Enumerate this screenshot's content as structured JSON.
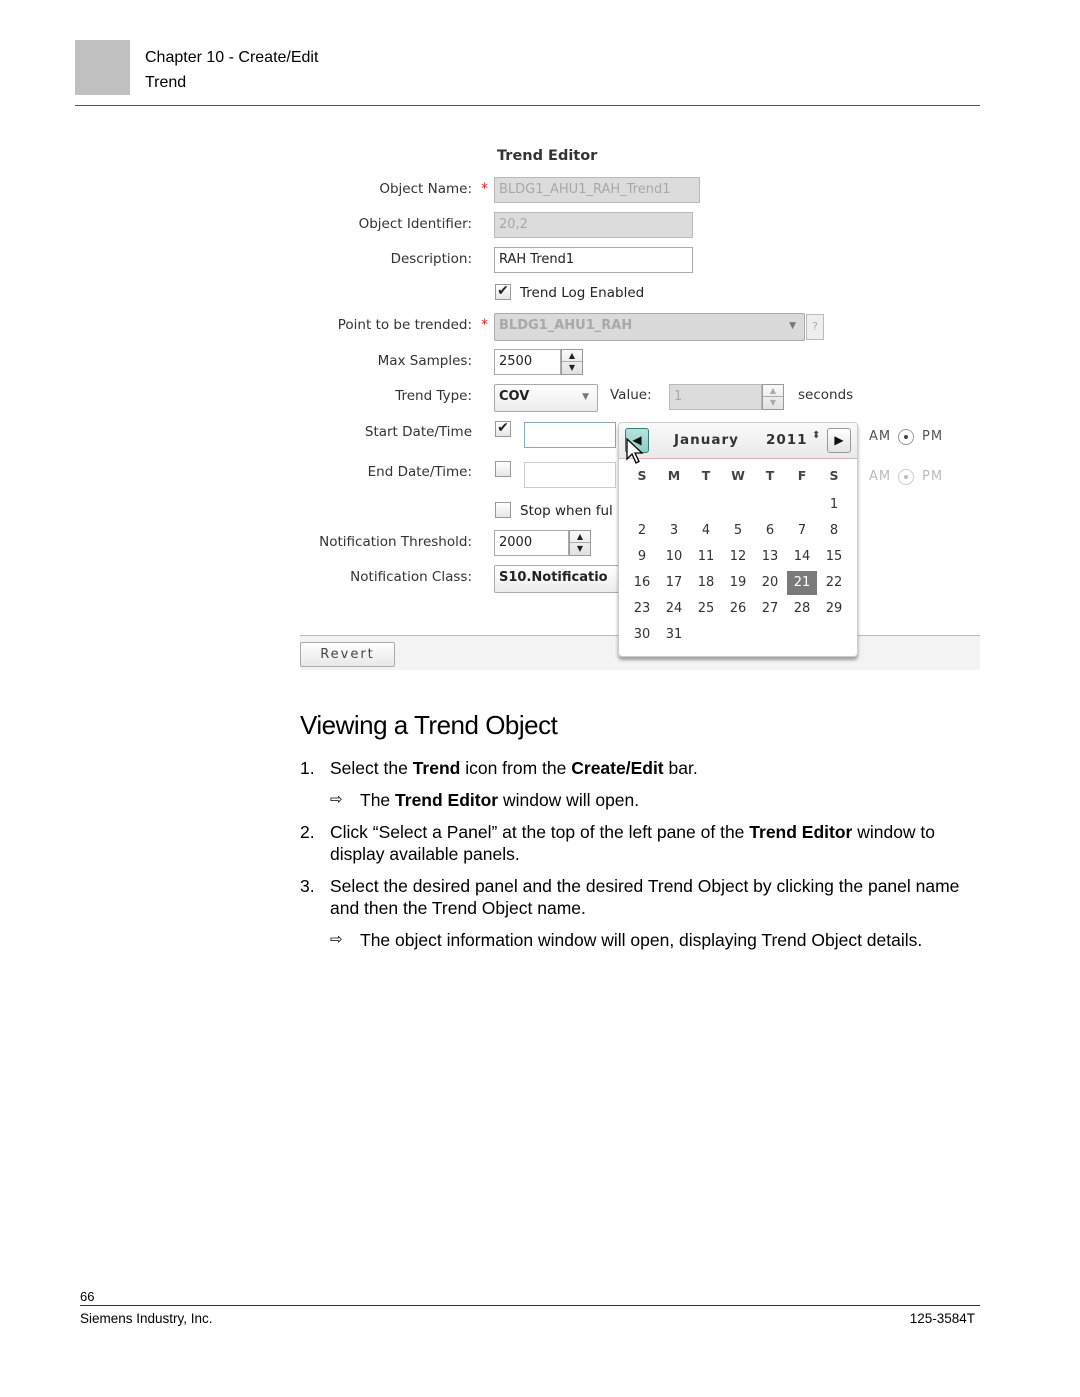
{
  "header": {
    "chapter": "Chapter 10 - Create/Edit",
    "section": "Trend"
  },
  "editor": {
    "title": "Trend Editor",
    "object_name": {
      "label": "Object Name:",
      "required_mark": "*",
      "value": "BLDG1_AHU1_RAH_Trend1",
      "disabled": true
    },
    "object_identifier": {
      "label": "Object Identifier:",
      "value": "20,2",
      "disabled": true
    },
    "description": {
      "label": "Description:",
      "value": "RAH Trend1"
    },
    "trend_log_enabled": {
      "label": "Trend Log Enabled",
      "checked": true,
      "check_glyph": "✔"
    },
    "point_to_be_trended": {
      "label": "Point to be trended:",
      "required_mark": "*",
      "value": "BLDG1_AHU1_RAH",
      "help_label": "?"
    },
    "max_samples": {
      "label": "Max Samples:",
      "value": "2500"
    },
    "trend_type": {
      "label": "Trend Type:",
      "value": "COV"
    },
    "value_field": {
      "label": "Value:",
      "value": "1",
      "unit": "seconds",
      "disabled": true
    },
    "start_datetime": {
      "label": "Start Date/Time",
      "checked": true,
      "check_glyph": "✔",
      "value": ""
    },
    "end_datetime": {
      "label": "End Date/Time:",
      "checked": false,
      "value": ""
    },
    "ampm": {
      "am": "AM",
      "pm": "PM"
    },
    "stop_when_full": {
      "label": "Stop when ful",
      "checked": false
    },
    "notification_threshold": {
      "label": "Notification Threshold:",
      "value": "2000"
    },
    "notification_class": {
      "label": "Notification Class:",
      "value": "S10.Notificatio"
    },
    "revert_label": "Revert",
    "spinner": {
      "up": "▲",
      "down": "▼"
    },
    "dropdown_arrow": "▼"
  },
  "calendar": {
    "month": "January",
    "year": "2011",
    "prev_icon": "◀",
    "next_icon": "▶",
    "year_spin": "⬍",
    "weekdays": [
      "S",
      "M",
      "T",
      "W",
      "T",
      "F",
      "S"
    ],
    "first_weekday_index": 6,
    "days_in_month": 31,
    "selected_day": 21
  },
  "body": {
    "heading": "Viewing a Trend Object",
    "steps": [
      {
        "num": "1.",
        "parts": [
          {
            "t": "Select the "
          },
          {
            "t": "Trend",
            "b": true
          },
          {
            "t": " icon from the "
          },
          {
            "t": "Create/Edit",
            "b": true
          },
          {
            "t": " bar."
          }
        ]
      },
      {
        "num": "2.",
        "parts": [
          {
            "t": "Click “Select a Panel” at the top of the left pane of the "
          },
          {
            "t": "Trend Editor",
            "b": true
          },
          {
            "t": " window to display available panels."
          }
        ]
      },
      {
        "num": "3.",
        "parts": [
          {
            "t": "Select the desired panel and the desired Trend Object by clicking the panel name and then the Trend Object name."
          }
        ]
      }
    ],
    "results": [
      {
        "arrow": "⇨",
        "parts": [
          {
            "t": "The "
          },
          {
            "t": "Trend Editor",
            "b": true
          },
          {
            "t": " window will open."
          }
        ]
      },
      {
        "arrow": "⇨",
        "parts": [
          {
            "t": "The object information window will open, displaying Trend Object details."
          }
        ]
      }
    ]
  },
  "footer": {
    "page_number": "66",
    "company": "Siemens Industry, Inc.",
    "doc_number": "125-3584T"
  }
}
